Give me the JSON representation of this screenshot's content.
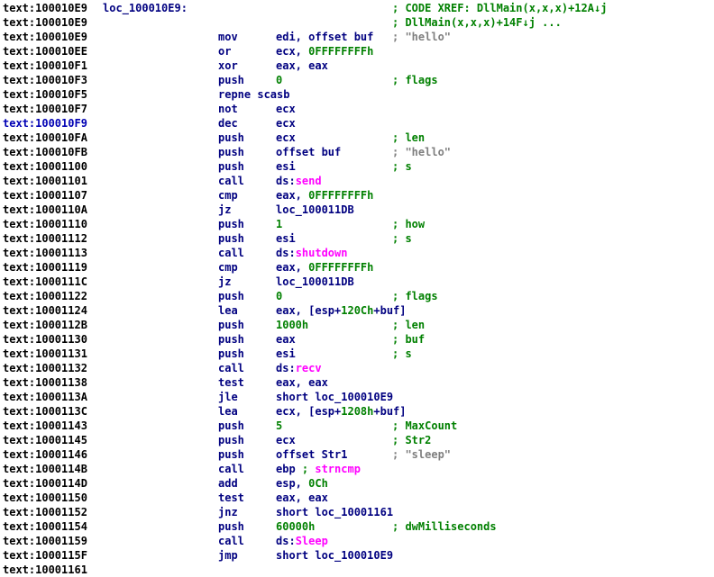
{
  "colors": {
    "text": "#000080",
    "address": "#000000",
    "current_address": "#0000b4",
    "comment": "#008000",
    "string_comment": "#7f7f7f",
    "number": "#008000",
    "import": "#ff00ff"
  },
  "lines": [
    {
      "addr": "text:100010E9",
      "label": "loc_100010E9:",
      "comment": "; CODE XREF: DllMain(x,x,x)+12A",
      "arrow": "↓",
      "comment2": "j"
    },
    {
      "addr": "text:100010E9",
      "comment": "; DllMain(x,x,x)+14F",
      "arrow": "↓",
      "comment2": "j ..."
    },
    {
      "addr": "text:100010E9",
      "mnem": "mov",
      "op": "edi, offset buf",
      "cmt_grey": "; \"hello\""
    },
    {
      "addr": "text:100010EE",
      "mnem": "or",
      "op": "ecx, ",
      "op_num": "0FFFFFFFFh"
    },
    {
      "addr": "text:100010F1",
      "mnem": "xor",
      "op": "eax, eax"
    },
    {
      "addr": "text:100010F3",
      "mnem": "push",
      "op_num": "0",
      "comment": "; flags"
    },
    {
      "addr": "text:100010F5",
      "mnem": "repne scasb"
    },
    {
      "addr": "text:100010F7",
      "mnem": "not",
      "op": "ecx"
    },
    {
      "addr": "text:100010F9",
      "current": true,
      "mnem": "dec",
      "op": "ecx"
    },
    {
      "addr": "text:100010FA",
      "mnem": "push",
      "op": "ecx",
      "comment": "; len"
    },
    {
      "addr": "text:100010FB",
      "mnem": "push",
      "op": "offset buf",
      "cmt_grey": "; \"hello\""
    },
    {
      "addr": "text:10001100",
      "mnem": "push",
      "op": "esi",
      "comment": "; s"
    },
    {
      "addr": "text:10001101",
      "mnem": "call",
      "op": "ds:",
      "op_imp": "send"
    },
    {
      "addr": "text:10001107",
      "mnem": "cmp",
      "op": "eax, ",
      "op_num": "0FFFFFFFFh"
    },
    {
      "addr": "text:1000110A",
      "mnem": "jz",
      "op": "loc_100011DB"
    },
    {
      "addr": "text:10001110",
      "mnem": "push",
      "op_num": "1",
      "comment": "; how"
    },
    {
      "addr": "text:10001112",
      "mnem": "push",
      "op": "esi",
      "comment": "; s"
    },
    {
      "addr": "text:10001113",
      "mnem": "call",
      "op": "ds:",
      "op_imp": "shutdown"
    },
    {
      "addr": "text:10001119",
      "mnem": "cmp",
      "op": "eax, ",
      "op_num": "0FFFFFFFFh"
    },
    {
      "addr": "text:1000111C",
      "mnem": "jz",
      "op": "loc_100011DB"
    },
    {
      "addr": "text:10001122",
      "mnem": "push",
      "op_num": "0",
      "comment": "; flags"
    },
    {
      "addr": "text:10001124",
      "mnem": "lea",
      "op": "eax, [esp+",
      "op_num": "120Ch",
      "op_tail": "+buf]"
    },
    {
      "addr": "text:1000112B",
      "mnem": "push",
      "op_num": "1000h",
      "comment": "; len"
    },
    {
      "addr": "text:10001130",
      "mnem": "push",
      "op": "eax",
      "comment": "; buf"
    },
    {
      "addr": "text:10001131",
      "mnem": "push",
      "op": "esi",
      "comment": "; s"
    },
    {
      "addr": "text:10001132",
      "mnem": "call",
      "op": "ds:",
      "op_imp": "recv"
    },
    {
      "addr": "text:10001138",
      "mnem": "test",
      "op": "eax, eax"
    },
    {
      "addr": "text:1000113A",
      "mnem": "jle",
      "op": "short loc_100010E9"
    },
    {
      "addr": "text:1000113C",
      "mnem": "lea",
      "op": "ecx, [esp+",
      "op_num": "1208h",
      "op_tail": "+buf]"
    },
    {
      "addr": "text:10001143",
      "mnem": "push",
      "op_num": "5",
      "comment": "; MaxCount"
    },
    {
      "addr": "text:10001145",
      "mnem": "push",
      "op": "ecx",
      "comment": "; Str2"
    },
    {
      "addr": "text:10001146",
      "mnem": "push",
      "op": "offset Str1",
      "cmt_grey": "; \"sleep\""
    },
    {
      "addr": "text:1000114B",
      "mnem": "call",
      "op": "ebp ",
      "op_semi": "; ",
      "op_imp": "strncmp"
    },
    {
      "addr": "text:1000114D",
      "mnem": "add",
      "op": "esp, ",
      "op_num": "0Ch"
    },
    {
      "addr": "text:10001150",
      "mnem": "test",
      "op": "eax, eax"
    },
    {
      "addr": "text:10001152",
      "mnem": "jnz",
      "op": "short loc_10001161"
    },
    {
      "addr": "text:10001154",
      "mnem": "push",
      "op_num": "60000h",
      "comment": "; dwMilliseconds"
    },
    {
      "addr": "text:10001159",
      "mnem": "call",
      "op": "ds:",
      "op_imp": "Sleep"
    },
    {
      "addr": "text:1000115F",
      "mnem": "jmp",
      "op": "short loc_100010E9"
    },
    {
      "addr": "text:10001161"
    }
  ]
}
